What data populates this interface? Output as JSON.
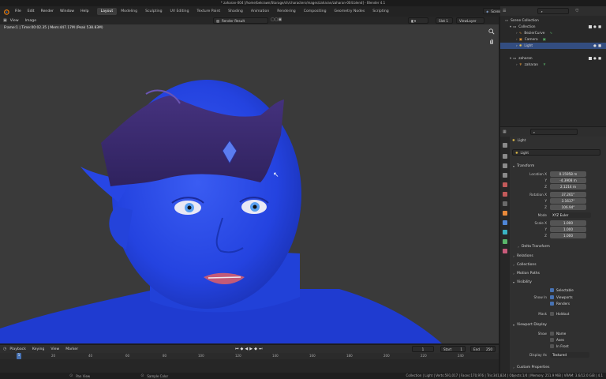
{
  "window": {
    "title": "* zaharan-004 [/home/bekrawn/Storage/ch/characters/mages/zaharan/zaharan-004.blend] - Blender 4.1"
  },
  "menu": {
    "items": [
      "File",
      "Edit",
      "Render",
      "Window",
      "Help"
    ]
  },
  "workspaces": [
    "Layout",
    "Modeling",
    "Sculpting",
    "UV Editing",
    "Texture Paint",
    "Shading",
    "Animation",
    "Rendering",
    "Compositing",
    "Geometry Nodes",
    "Scripting"
  ],
  "workspace_active": "Layout",
  "scene": {
    "name": "Scene",
    "view_layer": "ViewLayer"
  },
  "viewport": {
    "menus": [
      "View",
      "Image"
    ],
    "image_name": "Render Result",
    "slot": "Slot 1",
    "view_layer": "ViewLayer",
    "stats": "Frame:1 | Time:00:02.35 | Mem:447.17M (Peak 538.83M)"
  },
  "outliner": {
    "rows": [
      {
        "label": "Scene Collection",
        "indent": 0
      },
      {
        "label": "Collection",
        "indent": 1
      },
      {
        "label": "BezierCurve",
        "indent": 2
      },
      {
        "label": "Camera",
        "indent": 2
      },
      {
        "label": "Light",
        "indent": 2,
        "selected": true
      },
      {
        "label": "zaharan",
        "indent": 1
      },
      {
        "label": "zaharan",
        "indent": 2
      }
    ]
  },
  "properties": {
    "breadcrumb": "Light",
    "object_name": "Light",
    "transform": {
      "title": "Transform",
      "location_label": "Location X",
      "location": [
        "0.15958 m",
        "-4.3908 m",
        "2.1214 m"
      ],
      "rotation_label": "Rotation X",
      "rotation": [
        "37.261°",
        "3.1637°",
        "106.94°"
      ],
      "mode_label": "Mode",
      "mode": "XYZ Euler",
      "scale_label": "Scale X",
      "scale": [
        "1.000",
        "1.000",
        "1.000"
      ],
      "axis_y": "Y",
      "axis_z": "Z"
    },
    "panels_collapsed": [
      "Delta Transform",
      "Relations",
      "Collections",
      "Motion Paths"
    ],
    "visibility": {
      "title": "Visibility",
      "selectable": "Selectable",
      "show_in_label": "Show In",
      "viewports": "Viewports",
      "renders": "Renders",
      "mask_label": "Mask",
      "holdout": "Holdout"
    },
    "viewport_display": {
      "title": "Viewport Display",
      "show_label": "Show",
      "name": "Name",
      "axes": "Axes",
      "in_front": "In Front",
      "display_as_label": "Display As",
      "display_as": "Textured"
    },
    "custom_properties": "Custom Properties"
  },
  "timeline": {
    "menus": [
      "Playback",
      "Keying",
      "View",
      "Marker"
    ],
    "current_frame": "1",
    "start_label": "Start",
    "start": "1",
    "end_label": "End",
    "end": "250",
    "ticks": [
      "1",
      "20",
      "40",
      "60",
      "80",
      "100",
      "120",
      "140",
      "160",
      "180",
      "200",
      "220",
      "240"
    ]
  },
  "status": {
    "left": [
      "Pan View",
      "Sample Color"
    ],
    "right": "Collection | Light | Verts:591,017 | Faces:170,976 | Tris:341,824 | Objects:1/4 | Memory: 251.9 MiB | VRAM: 3.6/12.0 GiB | 4.1"
  },
  "colors": {
    "accent": "#4772b3",
    "skin": "#2244e6",
    "crown": "#3a2a72",
    "bg": "#3a3a3a"
  }
}
